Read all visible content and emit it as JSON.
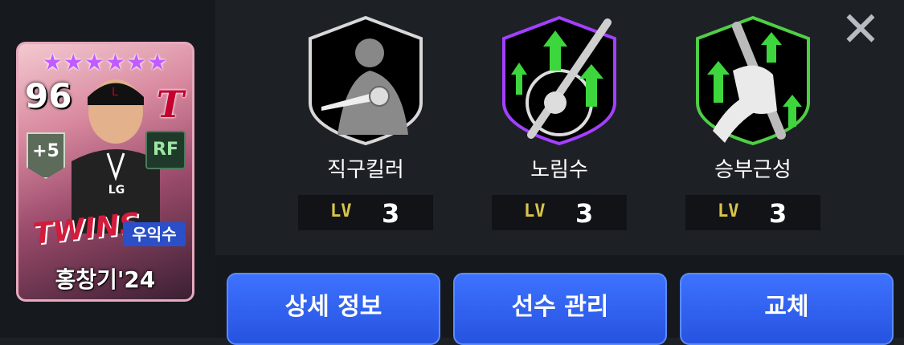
{
  "card": {
    "stars": "★★★★★★",
    "overall": "96",
    "plus": "+5",
    "position": "RF",
    "team_logo": "T",
    "team_text": "TWINS",
    "chest_text": "LG",
    "handedness": "우익수",
    "name": "홍창기'24"
  },
  "skills": [
    {
      "name": "직구킬러",
      "lv_tag": "LV",
      "level": "3",
      "icon": "fastball-killer-icon"
    },
    {
      "name": "노림수",
      "lv_tag": "LV",
      "level": "3",
      "icon": "aim-bat-icon"
    },
    {
      "name": "승부근성",
      "lv_tag": "LV",
      "level": "3",
      "icon": "grip-bat-icon"
    }
  ],
  "buttons": {
    "detail": "상세 정보",
    "manage": "선수 관리",
    "swap": "교체"
  },
  "close": "✕",
  "colors": {
    "primary_button": "#2f62f0",
    "skill2_border": "#a340ff",
    "skill3_border": "#4fcf45",
    "skill1_border": "#e0e0e0",
    "level_tag": "#d8c44a"
  }
}
